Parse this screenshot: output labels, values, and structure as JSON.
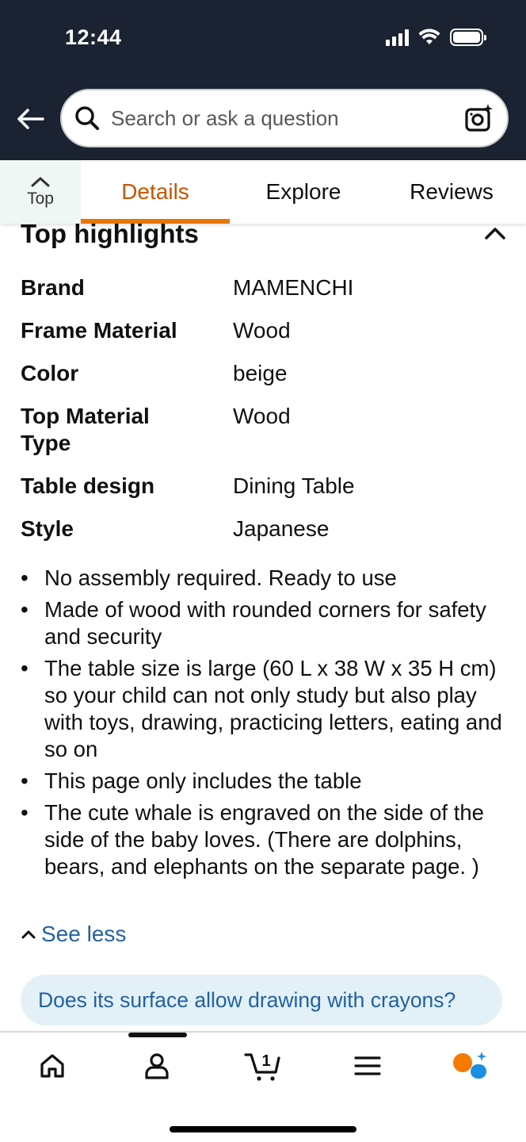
{
  "status_bar": {
    "time": "12:44"
  },
  "search": {
    "placeholder": "Search or ask a question"
  },
  "tabs": {
    "top_label": "Top",
    "items": [
      {
        "label": "Details",
        "active": true
      },
      {
        "label": "Explore",
        "active": false
      },
      {
        "label": "Reviews",
        "active": false
      }
    ]
  },
  "highlights": {
    "title": "Top highlights",
    "specs": [
      {
        "key": "Brand",
        "value": "MAMENCHI"
      },
      {
        "key": "Frame Material",
        "value": "Wood"
      },
      {
        "key": "Color",
        "value": "beige"
      },
      {
        "key": "Top Material Type",
        "value": "Wood"
      },
      {
        "key": "Table design",
        "value": "Dining Table"
      },
      {
        "key": "Style",
        "value": "Japanese"
      }
    ],
    "bullets": [
      "No assembly required. Ready to use",
      "Made of wood with rounded corners for safety and security",
      "The table size is large (60 L x 38 W x 35 H cm) so your child can not only study but also play with toys, drawing, practicing letters, eating and so on",
      "This page only includes the table",
      "The cute whale is engraved on the side of the side of the baby loves. (There are dolphins, bears, and elephants on the separate page. )"
    ],
    "see_less": "See less"
  },
  "question_chip": {
    "text": "Does its surface allow drawing with crayons?"
  },
  "bottom_nav": {
    "cart_count": "1",
    "items": [
      "home-icon",
      "account-icon",
      "cart-icon",
      "menu-icon",
      "rufus-icon"
    ]
  },
  "colors": {
    "header_bg": "#1b2332",
    "active_tab": "#c45500",
    "tab_underline": "#e77600",
    "link": "#2162a1",
    "chip_bg": "#e3f0f7",
    "rufus_orange": "#f57a00",
    "rufus_blue": "#1a8fe3"
  }
}
